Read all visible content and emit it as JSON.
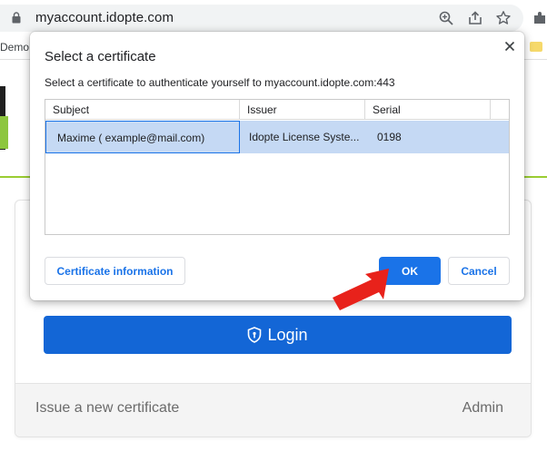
{
  "browser": {
    "url": "myaccount.idopte.com",
    "bookmark_label": "Demo"
  },
  "page": {
    "login_label": "Login",
    "issue_link": "Issue a new certificate",
    "admin_link": "Admin"
  },
  "dialog": {
    "title": "Select a certificate",
    "description": "Select a certificate to authenticate yourself to myaccount.idopte.com:443",
    "columns": [
      "Subject",
      "Issuer",
      "Serial"
    ],
    "rows": [
      {
        "subject": "Maxime ( example@mail.com)",
        "issuer": "Idopte License Syste...",
        "serial": "0198"
      }
    ],
    "cert_info_label": "Certificate information",
    "ok_label": "OK",
    "cancel_label": "Cancel"
  },
  "colors": {
    "accent": "#1a73e8",
    "login_button": "#1366d6",
    "selection": "#c5d9f4",
    "arrow": "#e8221b",
    "brand_green": "#8dc63f"
  }
}
